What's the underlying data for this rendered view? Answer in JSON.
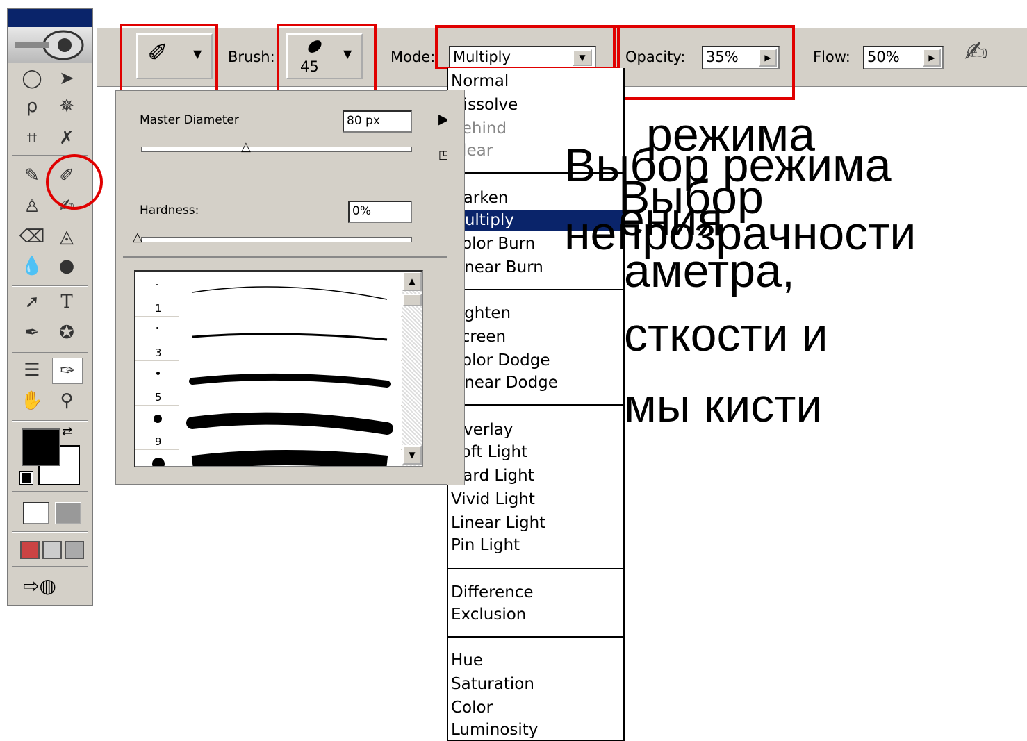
{
  "options_bar": {
    "brush_label": "Brush:",
    "brush_size": "45",
    "mode_label": "Mode:",
    "mode_value": "Multiply",
    "opacity_label": "Opacity:",
    "opacity_value": "35%",
    "flow_label": "Flow:",
    "flow_value": "50%"
  },
  "brush_panel": {
    "master_diameter_label": "Master Diameter",
    "master_diameter_value": "80 px",
    "hardness_label": "Hardness:",
    "hardness_value": "0%",
    "brushes": [
      "1",
      "3",
      "5",
      "9"
    ]
  },
  "mode_list": {
    "group1": [
      "Normal",
      "Dissolve",
      "Behind",
      "Clear"
    ],
    "group2": [
      "Darken",
      "Multiply",
      "Color Burn",
      "Linear Burn"
    ],
    "group3": [
      "Lighten",
      "Screen",
      "Color Dodge",
      "Linear Dodge"
    ],
    "group4": [
      "Overlay",
      "Soft Light",
      "Hard Light",
      "Vivid Light",
      "Linear Light",
      "Pin Light"
    ],
    "group5": [
      "Difference",
      "Exclusion"
    ],
    "group6": [
      "Hue",
      "Saturation",
      "Color",
      "Luminosity"
    ],
    "selected": "Multiply"
  },
  "overlay_text": {
    "back_line1": "режима",
    "back_line2": "ения",
    "back_line3": "аметра,",
    "back_line4": "сткости и",
    "back_line5": "мы кисти",
    "back_word": "Выбор",
    "front_line1": "Выбор режима",
    "front_line2": "непрозрачности"
  }
}
